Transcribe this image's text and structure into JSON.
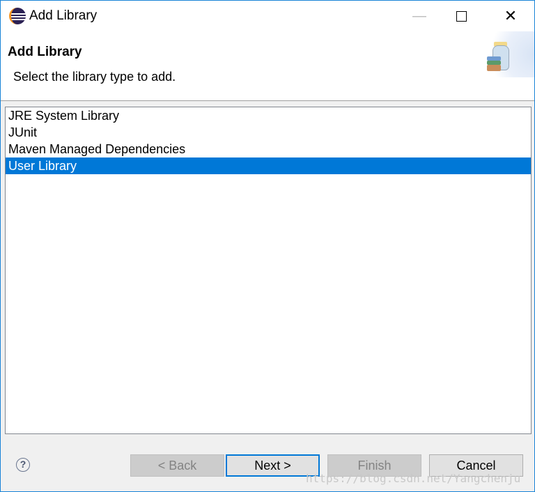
{
  "window": {
    "title": "Add Library",
    "minimize": "—",
    "close": "✕"
  },
  "header": {
    "title": "Add Library",
    "description": "Select the library type to add."
  },
  "library_types": [
    {
      "label": "JRE System Library",
      "selected": false
    },
    {
      "label": "JUnit",
      "selected": false
    },
    {
      "label": "Maven Managed Dependencies",
      "selected": false
    },
    {
      "label": "User Library",
      "selected": true
    }
  ],
  "footer": {
    "help": "?",
    "back": "< Back",
    "next": "Next >",
    "finish": "Finish",
    "cancel": "Cancel"
  },
  "watermark": "https://blog.csdn.net/Yangchenju"
}
